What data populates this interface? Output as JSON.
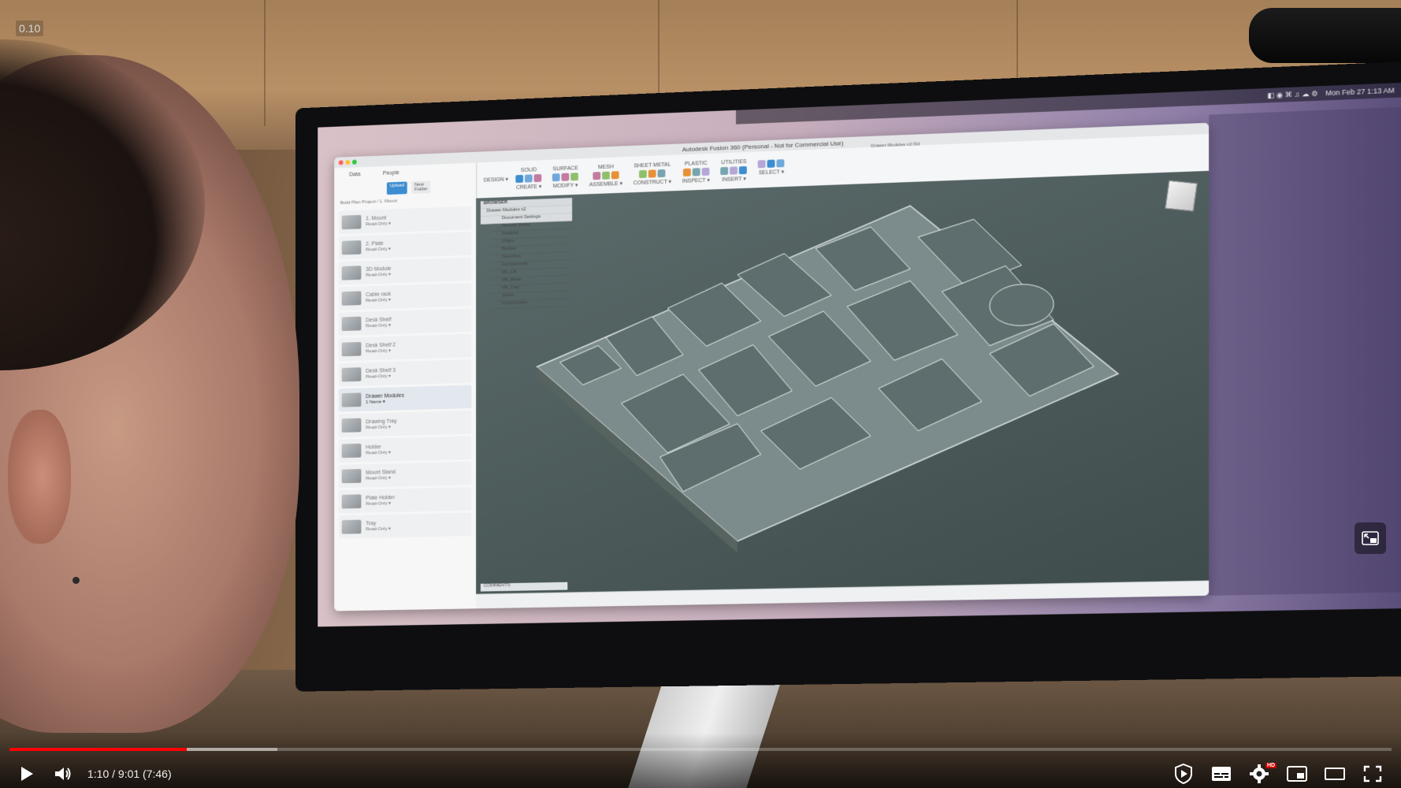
{
  "overlay": {
    "corner_tag": "0.10"
  },
  "app_window": {
    "title": "Autodesk Fusion 360 (Personal - Not for Commercial Use)",
    "document_tab": "Drawer Modules v2.f3d",
    "menubar_date": "Mon Feb 27  1:13 AM",
    "toolbar": {
      "workspace_label": "DESIGN ▾",
      "groups": [
        {
          "tab": "SOLID",
          "label": "CREATE ▾"
        },
        {
          "tab": "SURFACE",
          "label": "MODIFY ▾"
        },
        {
          "tab": "MESH",
          "label": "ASSEMBLE ▾"
        },
        {
          "tab": "SHEET METAL",
          "label": "CONSTRUCT ▾"
        },
        {
          "tab": "PLASTIC",
          "label": "INSPECT ▾"
        },
        {
          "tab": "UTILITIES",
          "label": "INSERT ▾"
        },
        {
          "tab": "",
          "label": "SELECT ▾"
        }
      ]
    },
    "data_panel": {
      "tabs": [
        "Data",
        "People"
      ],
      "upload_label": "Upload",
      "new_folder_label": "New Folder",
      "breadcrumb": "Build Plan Project / 1. Mount",
      "items": [
        {
          "name": "1. Mount",
          "status": "Read-Only ▾"
        },
        {
          "name": "2. Plate",
          "status": "Read-Only ▾"
        },
        {
          "name": "3D Module",
          "status": "Read-Only ▾"
        },
        {
          "name": "Cable rack",
          "status": "Read-Only ▾"
        },
        {
          "name": "Desk Shelf",
          "status": "Read-Only ▾"
        },
        {
          "name": "Desk Shelf 2",
          "status": "Read-Only ▾"
        },
        {
          "name": "Desk Shelf 3",
          "status": "Read-Only ▾"
        },
        {
          "name": "Drawer Modules",
          "status": "1 Name ▾"
        },
        {
          "name": "Drawing Tray",
          "status": "Read-Only ▾"
        },
        {
          "name": "Holder",
          "status": "Read-Only ▾"
        },
        {
          "name": "Mount Stand",
          "status": "Read-Only ▾"
        },
        {
          "name": "Plate Holder",
          "status": "Read-Only ▾"
        },
        {
          "name": "Tray",
          "status": "Read-Only ▾"
        }
      ]
    },
    "browser_tree": {
      "title": "BROWSER",
      "root": "Drawer Modules v2",
      "nodes": [
        "Document Settings",
        "Named Views",
        "Analysis",
        "Origin",
        "Bodies",
        "Sketches",
        "Components",
        "Mk_Lid",
        "Mk_Base",
        "Mk_Tray",
        "Joints",
        "Construction"
      ]
    },
    "comments_label": "COMMENTS"
  },
  "video_player": {
    "time_display": "1:10 / 9:01 (7:46)",
    "progress_played": 0.128,
    "progress_buffered": 0.194,
    "hd_badge": "HD",
    "icons": {
      "play": "play-icon",
      "volume": "volume-icon",
      "sponsor": "shield-play-icon",
      "subtitles": "subtitles-icon",
      "settings": "gear-icon",
      "miniplayer": "miniplayer-icon",
      "theater": "theater-mode-icon",
      "fullscreen": "fullscreen-icon",
      "pip_hint": "picture-in-picture-icon"
    },
    "colors": {
      "progress_played": "#ff0000",
      "hd_badge": "#cc0000"
    }
  }
}
